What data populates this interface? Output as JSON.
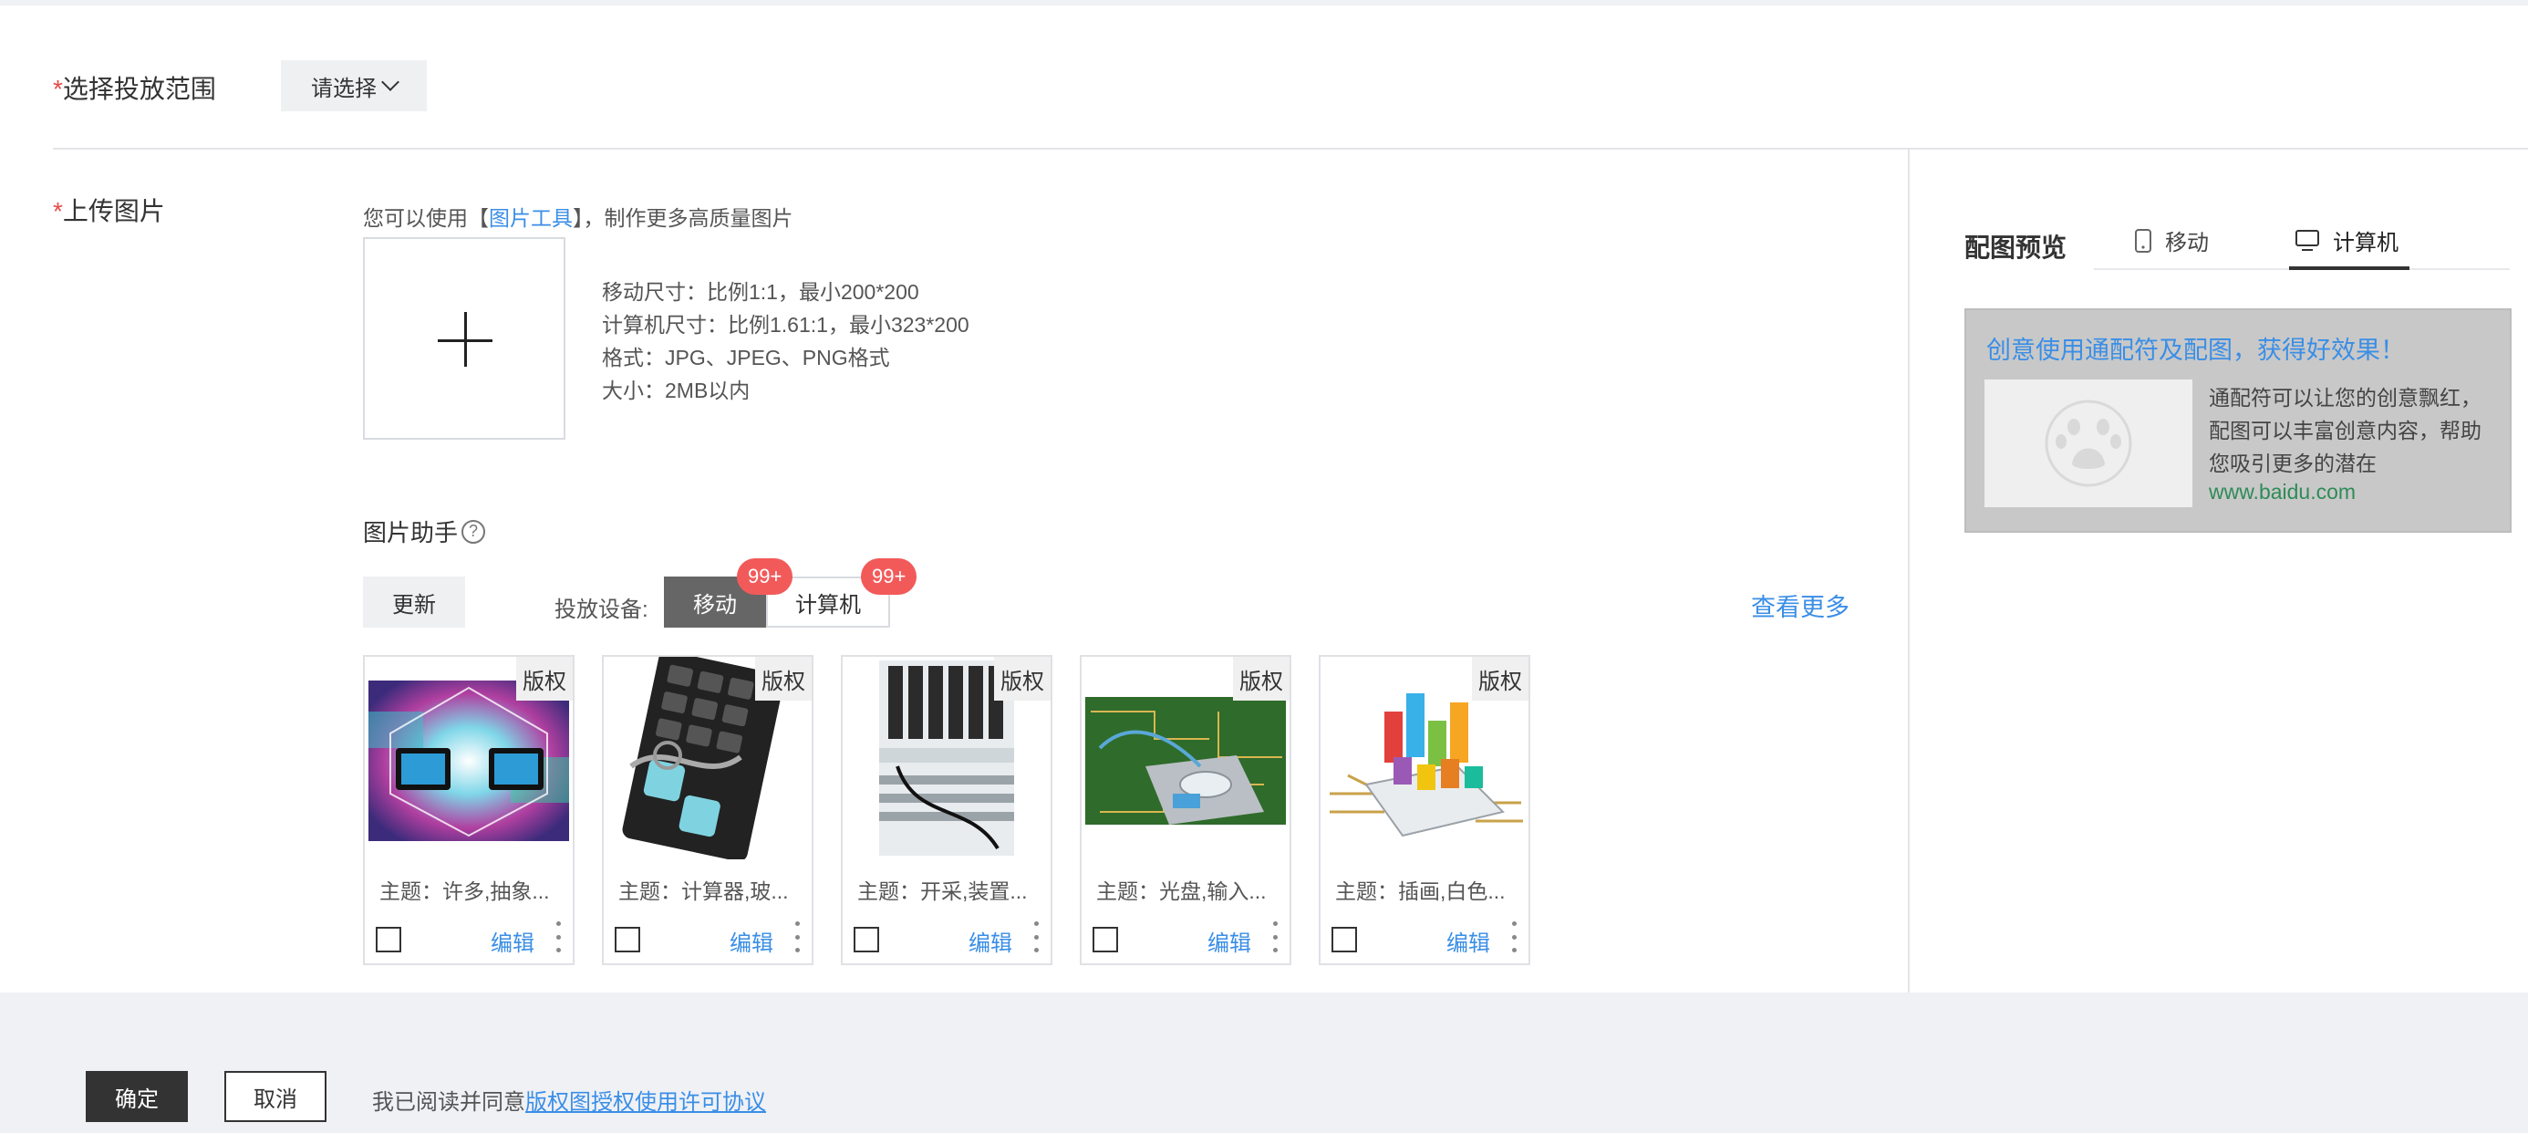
{
  "scope": {
    "required_mark": "*",
    "label": "选择投放范围",
    "select_value": "请选择"
  },
  "upload": {
    "required_mark": "*",
    "label": "上传图片",
    "tool_prefix": "您可以使用【",
    "tool_link": "图片工具",
    "tool_suffix": "】，制作更多高质量图片",
    "specs": [
      "移动尺寸：比例1:1，最小200*200",
      "计算机尺寸：比例1.61:1，最小323*200",
      "格式：JPG、JPEG、PNG格式",
      "大小：2MB以内"
    ]
  },
  "helper": {
    "title": "图片助手",
    "help_glyph": "?",
    "refresh_label": "更新",
    "device_label": "投放设备:",
    "device_mobile": "移动",
    "device_pc": "计算机",
    "badge_mobile": "99+",
    "badge_pc": "99+",
    "more_label": "查看更多",
    "cards": [
      {
        "copyright": "版权",
        "topic": "主题：许多,抽象...",
        "edit": "编辑"
      },
      {
        "copyright": "版权",
        "topic": "主题：计算器,玻...",
        "edit": "编辑"
      },
      {
        "copyright": "版权",
        "topic": "主题：开采,装置...",
        "edit": "编辑"
      },
      {
        "copyright": "版权",
        "topic": "主题：光盘,输入...",
        "edit": "编辑"
      },
      {
        "copyright": "版权",
        "topic": "主题：插画,白色...",
        "edit": "编辑"
      }
    ]
  },
  "preview": {
    "title": "配图预览",
    "tab_mobile": "移动",
    "tab_pc": "计算机",
    "headline": "创意使用通配符及配图，获得好效果！",
    "body": "通配符可以让您的创意飘红，配图可以丰富创意内容，帮助您吸引更多的潜在",
    "url": "www.baidu.com"
  },
  "footer": {
    "confirm": "确定",
    "cancel": "取消",
    "agree_prefix": "我已阅读并同意",
    "agree_link": "版权图授权使用许可协议"
  }
}
